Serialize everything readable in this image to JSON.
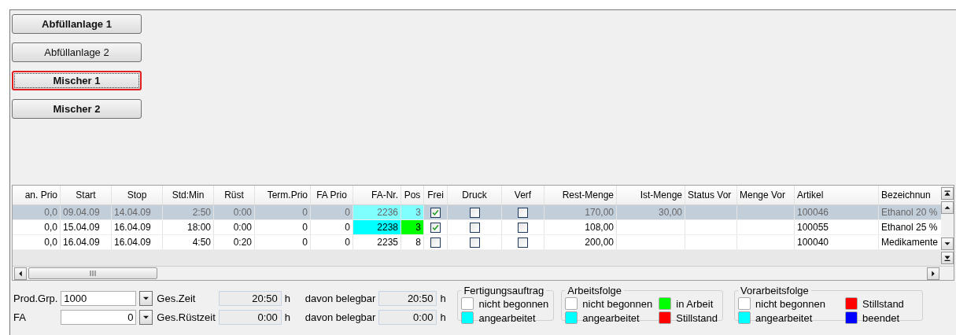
{
  "machines": [
    {
      "label": "Abfüllanlage 1",
      "bold": true,
      "selected": false
    },
    {
      "label": "Abfüllanlage 2",
      "bold": false,
      "selected": false
    },
    {
      "label": "Mischer 1",
      "bold": true,
      "selected": true
    },
    {
      "label": "Mischer 2",
      "bold": true,
      "selected": false
    }
  ],
  "table": {
    "columns": [
      "an. Prio",
      "Start",
      "Stop",
      "Std:Min",
      "Rüst",
      "Term.Prio",
      "FA Prio",
      "FA-Nr.",
      "Pos",
      "Frei",
      "Druck",
      "Verf",
      "Rest-Menge",
      "Ist-Menge",
      "Status Vor",
      "Menge Vor",
      "Artikel",
      "Bezeichnun"
    ],
    "rows": [
      {
        "selected": true,
        "man_prio": "0,0",
        "start": "09.04.09",
        "stop": "14.04.09",
        "std_min": "2:50",
        "ruest": "0:00",
        "term_prio": "0",
        "fa_prio": "0",
        "fa_nr": {
          "text": "2236",
          "color": "#80ffff"
        },
        "pos": {
          "text": "3",
          "color": "#80ffff"
        },
        "frei": true,
        "druck": false,
        "verf": false,
        "rest_menge": "170,00",
        "ist_menge": "30,00",
        "artikel": "100046",
        "bezeichnung": "Ethanol 20 %"
      },
      {
        "selected": false,
        "man_prio": "0,0",
        "start": "15.04.09",
        "stop": "16.04.09",
        "std_min": "18:00",
        "ruest": "0:00",
        "term_prio": "0",
        "fa_prio": "0",
        "fa_nr": {
          "text": "2238",
          "color": "#00ffff"
        },
        "pos": {
          "text": "3",
          "color": "#00ff00"
        },
        "frei": true,
        "druck": false,
        "verf": false,
        "rest_menge": "108,00",
        "artikel": "100055",
        "bezeichnung": "Ethanol 25 %"
      },
      {
        "selected": false,
        "man_prio": "0,0",
        "start": "16.04.09",
        "stop": "16.04.09",
        "std_min": "4:50",
        "ruest": "0:20",
        "term_prio": "0",
        "fa_prio": "0",
        "fa_nr": {
          "text": "2235"
        },
        "pos": {
          "text": "8"
        },
        "frei": false,
        "druck": false,
        "verf": false,
        "rest_menge": "200,00",
        "artikel": "100040",
        "bezeichnung": "Medikamente"
      }
    ]
  },
  "fields": [
    {
      "label": "Prod.Grp.",
      "value": "1000"
    },
    {
      "label": "FA",
      "value": "0"
    }
  ],
  "times": [
    {
      "label": "Ges.Zeit",
      "value": "20:50",
      "unit": "h",
      "sub_label": "davon belegbar",
      "sub_value": "20:50",
      "sub_unit": "h"
    },
    {
      "label": "Ges.Rüstzeit",
      "value": "0:00",
      "unit": "h",
      "sub_label": "davon belegbar",
      "sub_value": "0:00",
      "sub_unit": "h"
    }
  ],
  "legends": [
    {
      "title": "Fertigungsauftrag",
      "items": [
        {
          "label": "nicht begonnen",
          "color": "#ffffff"
        },
        {
          "label": "angearbeitet",
          "color": "#00ffff"
        }
      ]
    },
    {
      "title": "Arbeitsfolge",
      "items": [
        {
          "label": "nicht begonnen",
          "color": "#ffffff"
        },
        {
          "label": "angearbeitet",
          "color": "#00ffff"
        },
        {
          "label": "in Arbeit",
          "color": "#00ff00"
        },
        {
          "label": "Stillstand",
          "color": "#ff0000"
        }
      ]
    },
    {
      "title": "Vorarbeitsfolge",
      "items": [
        {
          "label": "nicht begonnen",
          "color": "#ffffff"
        },
        {
          "label": "angearbeitet",
          "color": "#00ffff"
        },
        {
          "label": "Stillstand",
          "color": "#ff0000"
        },
        {
          "label": "beendet",
          "color": "#0000ff"
        }
      ]
    }
  ]
}
